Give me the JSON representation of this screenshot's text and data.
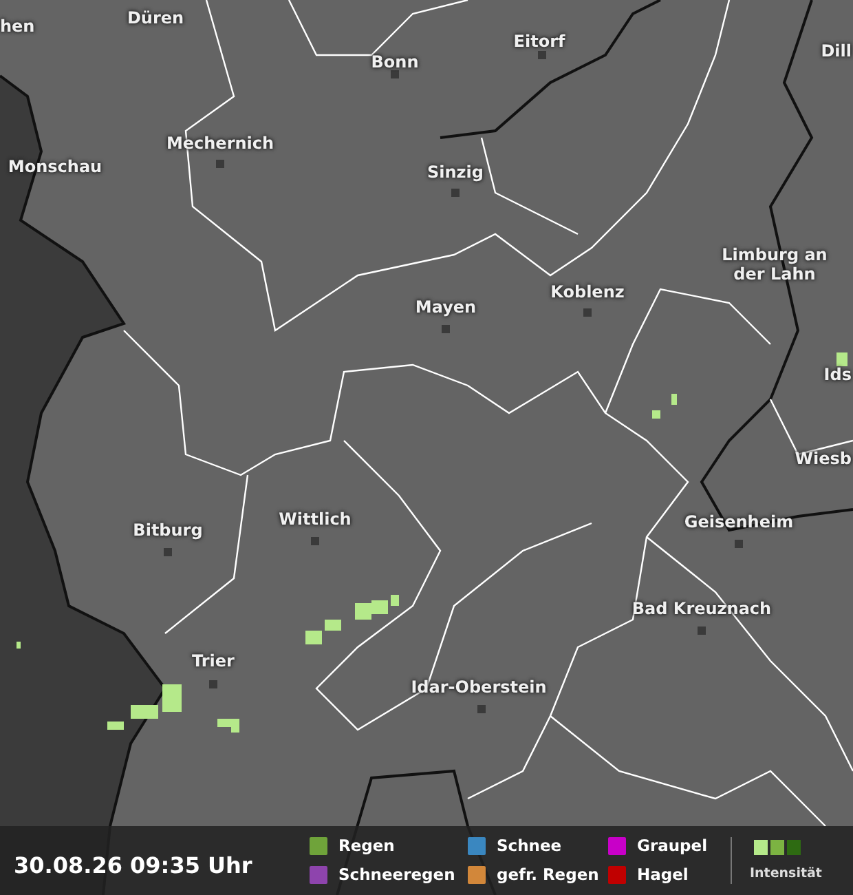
{
  "map": {
    "places": [
      {
        "label": "hen"
      },
      {
        "label": "Düren"
      },
      {
        "label": "Bonn"
      },
      {
        "label": "Eitorf"
      },
      {
        "label": "Dill"
      },
      {
        "label": "Mechernich"
      },
      {
        "label": "Monschau"
      },
      {
        "label": "Sinzig"
      },
      {
        "label": "Limburg an der Lahn"
      },
      {
        "label": "Mayen"
      },
      {
        "label": "Koblenz"
      },
      {
        "label": "Ids"
      },
      {
        "label": "Wiesb"
      },
      {
        "label": "Bitburg"
      },
      {
        "label": "Wittlich"
      },
      {
        "label": "Geisenheim"
      },
      {
        "label": "Bad Kreuznach"
      },
      {
        "label": "Trier"
      },
      {
        "label": "Idar-Oberstein"
      }
    ]
  },
  "footer": {
    "timestamp": "30.08.26 09:35 Uhr",
    "legend": [
      {
        "label": "Regen",
        "color": "#6fa33a"
      },
      {
        "label": "Schneeregen",
        "color": "#8e44ad"
      },
      {
        "label": "Schnee",
        "color": "#3a87c0"
      },
      {
        "label": "gefr. Regen",
        "color": "#d2873a"
      },
      {
        "label": "Graupel",
        "color": "#c800c8"
      },
      {
        "label": "Hagel",
        "color": "#c00000"
      }
    ],
    "intensity": {
      "label": "Intensität",
      "swatches": [
        {
          "color": "#b5e98a"
        },
        {
          "color": "#7cb342"
        },
        {
          "color": "#2e6b12"
        }
      ]
    }
  }
}
